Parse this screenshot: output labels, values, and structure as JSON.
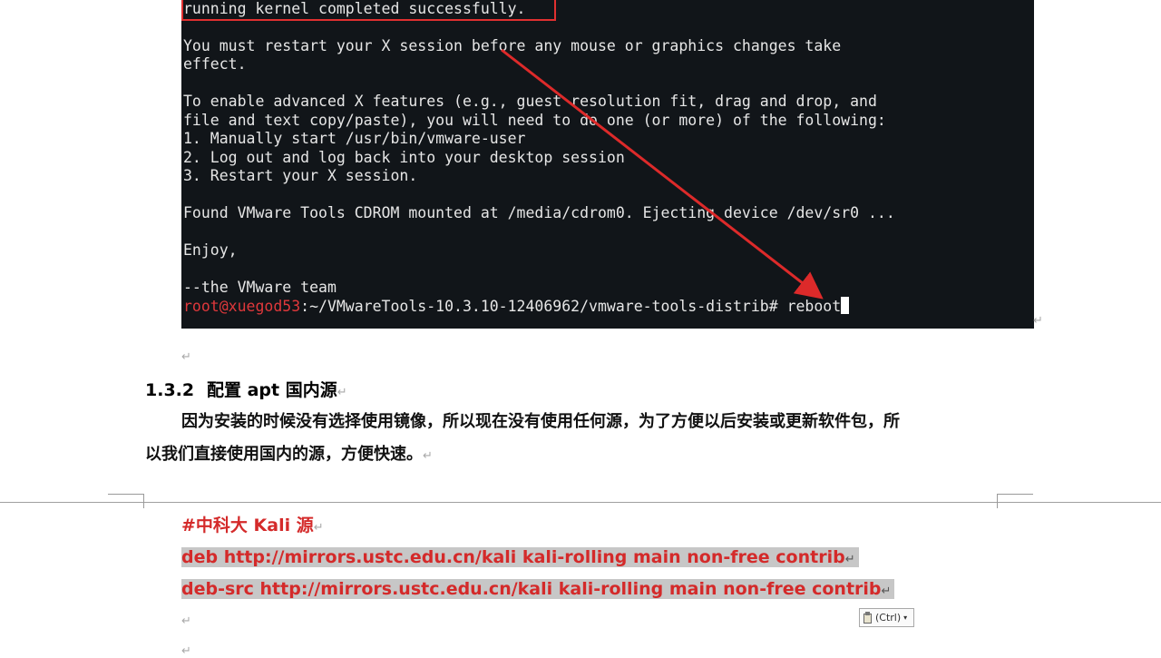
{
  "terminal": {
    "lines": [
      "running kernel completed successfully.",
      "You must restart your X session before any mouse or graphics changes take",
      "effect.",
      "To enable advanced X features (e.g., guest resolution fit, drag and drop, and",
      "file and text copy/paste), you will need to do one (or more) of the following:",
      "1. Manually start /usr/bin/vmware-user",
      "2. Log out and log back into your desktop session",
      "3. Restart your X session.",
      "Found VMware Tools CDROM mounted at /media/cdrom0. Ejecting device /dev/sr0 ...",
      "Enjoy,",
      "--the VMware team"
    ],
    "prompt_user": "root@xuegod53",
    "prompt_path": ":~/VMwareTools-10.3.10-12406962/vmware-tools-distrib# reboot",
    "highlight_color": "#e03030"
  },
  "document": {
    "return_mark": "↵",
    "heading_number": "1.3.2",
    "heading_text": "配置 apt 国内源",
    "para_line1": "因为安装的时候没有选择使用镜像，所以现在没有使用任何源，为了方便以后安装或更新软件包，所",
    "para_line2": "以我们直接使用国内的源，方便快速。",
    "comment_line": "#中科大 Kali 源",
    "deb_line": "deb http://mirrors.ustc.edu.cn/kali kali-rolling main non-free contrib",
    "debsrc_line": "deb-src http://mirrors.ustc.edu.cn/kali kali-rolling main non-free contrib",
    "accent_color": "#d42a2a"
  },
  "paste_options": {
    "label": "(Ctrl)",
    "icon": "clipboard-icon",
    "dropdown_icon": "▾"
  }
}
